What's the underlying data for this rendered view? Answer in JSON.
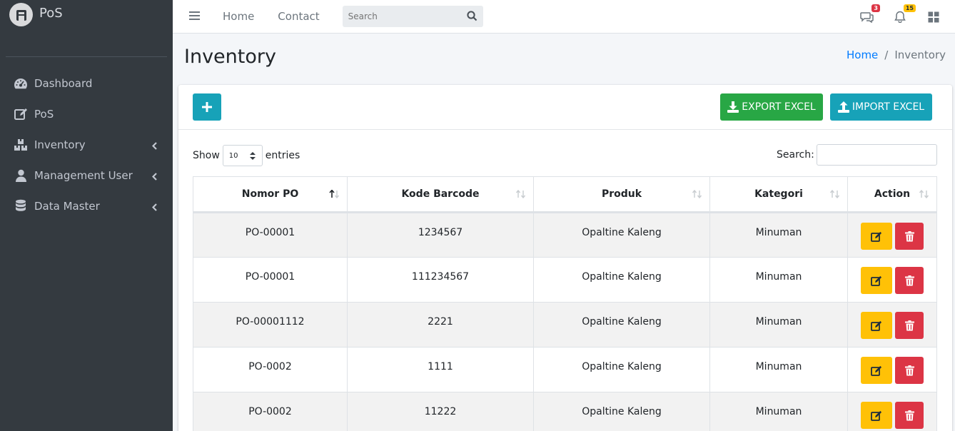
{
  "brand": {
    "name": "PoS"
  },
  "sidebar": {
    "items": [
      {
        "label": "Dashboard",
        "icon": "tachometer-icon",
        "has_caret": false
      },
      {
        "label": "PoS",
        "icon": "edit-icon",
        "has_caret": false
      },
      {
        "label": "Inventory",
        "icon": "boxes-icon",
        "has_caret": true
      },
      {
        "label": "Management User",
        "icon": "user-icon",
        "has_caret": true
      },
      {
        "label": "Data Master",
        "icon": "database-icon",
        "has_caret": true
      }
    ]
  },
  "topbar": {
    "links": [
      "Home",
      "Contact"
    ],
    "search_placeholder": "Search",
    "messages_badge": "3",
    "notifications_badge": "15"
  },
  "page": {
    "title": "Inventory",
    "breadcrumb": {
      "home": "Home",
      "current": "Inventory"
    }
  },
  "card": {
    "export_label": "EXPORT EXCEL",
    "import_label": "IMPORT EXCEL"
  },
  "datatable": {
    "show_label": "Show",
    "entries_label": "entries",
    "page_length": "10",
    "search_label": "Search:",
    "columns": [
      "Nomor PO",
      "Kode Barcode",
      "Produk",
      "Kategori",
      "Action"
    ],
    "rows": [
      {
        "nomor_po": "PO-00001",
        "kode_barcode": "1234567",
        "produk": "Opaltine Kaleng",
        "kategori": "Minuman"
      },
      {
        "nomor_po": "PO-00001",
        "kode_barcode": "111234567",
        "produk": "Opaltine Kaleng",
        "kategori": "Minuman"
      },
      {
        "nomor_po": "PO-00001112",
        "kode_barcode": "2221",
        "produk": "Opaltine Kaleng",
        "kategori": "Minuman"
      },
      {
        "nomor_po": "PO-0002",
        "kode_barcode": "1111",
        "produk": "Opaltine Kaleng",
        "kategori": "Minuman"
      },
      {
        "nomor_po": "PO-0002",
        "kode_barcode": "11222",
        "produk": "Opaltine Kaleng",
        "kategori": "Minuman"
      }
    ]
  },
  "colors": {
    "sidebar_bg": "#343a40",
    "accent_info": "#17a2b8",
    "success": "#28a745",
    "warning": "#ffc107",
    "danger": "#dc3545",
    "link": "#007bff"
  }
}
